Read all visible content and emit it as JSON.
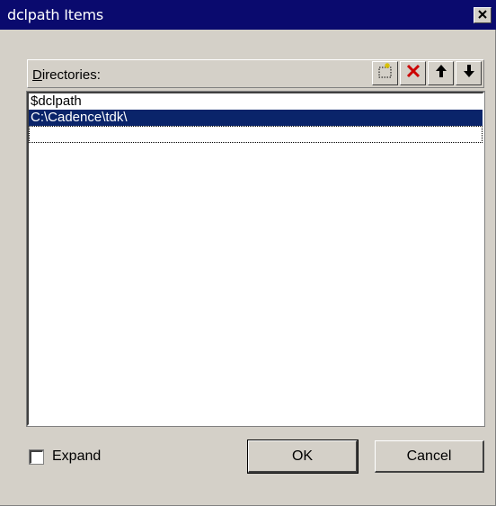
{
  "window": {
    "title": "dclpath Items"
  },
  "header": {
    "label_mnemonic": "D",
    "label_rest": "irectories:"
  },
  "toolbar": {
    "new_icon": "new-folder-icon",
    "delete_icon": "delete-x-icon",
    "up_icon": "arrow-up-icon",
    "down_icon": "arrow-down-icon",
    "delete_color": "#cc0000"
  },
  "list": {
    "items": [
      {
        "label": "$dclpath",
        "selected": false
      },
      {
        "label": "C:\\Cadence\\tdk\\",
        "selected": true
      },
      {
        "label": "",
        "editing": true
      }
    ]
  },
  "expand": {
    "label": "Expand",
    "checked": false
  },
  "buttons": {
    "ok_label": "OK",
    "cancel_label": "Cancel"
  },
  "colors": {
    "titlebar": "#0a0a6e",
    "selection": "#0a246a",
    "face": "#d4d0c8"
  }
}
